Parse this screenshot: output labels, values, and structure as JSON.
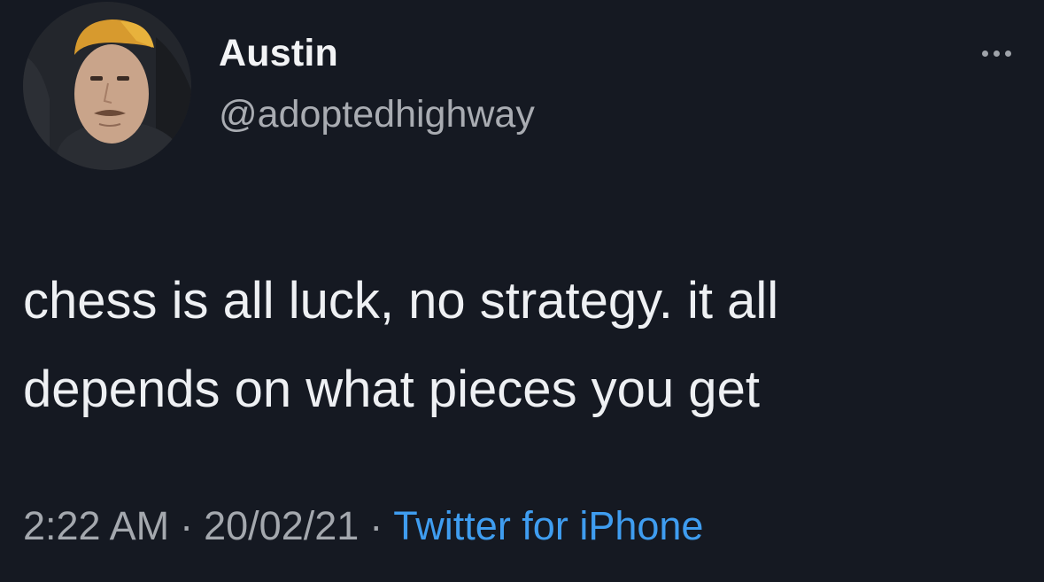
{
  "author": {
    "name": "Austin",
    "handle": "@adoptedhighway"
  },
  "tweet": {
    "line1": "chess is all luck, no strategy. it all",
    "line2": "depends on what pieces you get"
  },
  "meta": {
    "time": "2:22 AM",
    "separator": "·",
    "date": "20/02/21",
    "source": "Twitter for iPhone"
  },
  "colors": {
    "background": "#151922",
    "source_link": "#3f9df0"
  },
  "icons": {
    "menu": "more-options-icon"
  }
}
